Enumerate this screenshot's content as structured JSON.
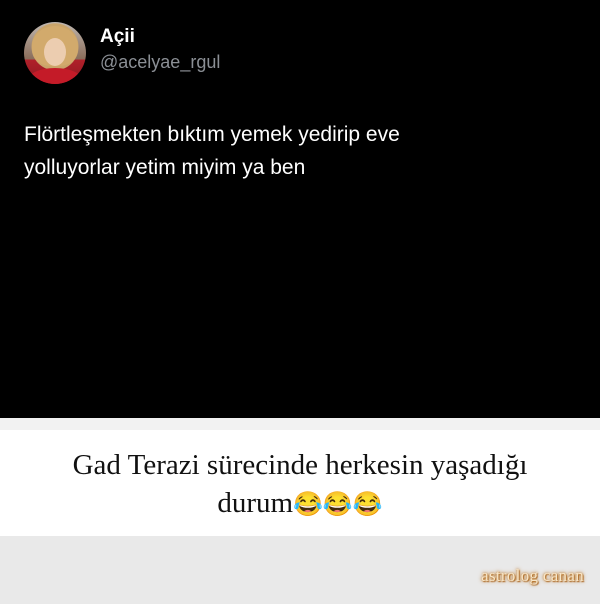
{
  "tweet": {
    "author_name": "Açii",
    "author_handle": "@acelyae_rgul",
    "text_line1": "Flörtleşmekten bıktım yemek yedirip eve",
    "text_line2": "yolluyorlar yetim miyim ya ben"
  },
  "caption": {
    "line1": "Gad Terazi sürecinde herkesin yaşadığı",
    "line2": "durum",
    "emoji": "😂😂😂"
  },
  "watermark": {
    "text": "astrolog canan"
  },
  "colors": {
    "tweet_bg": "#000000",
    "handle_gray": "#8b8f95",
    "caption_bg": "#ffffff",
    "page_bg": "#e9e9e9"
  }
}
